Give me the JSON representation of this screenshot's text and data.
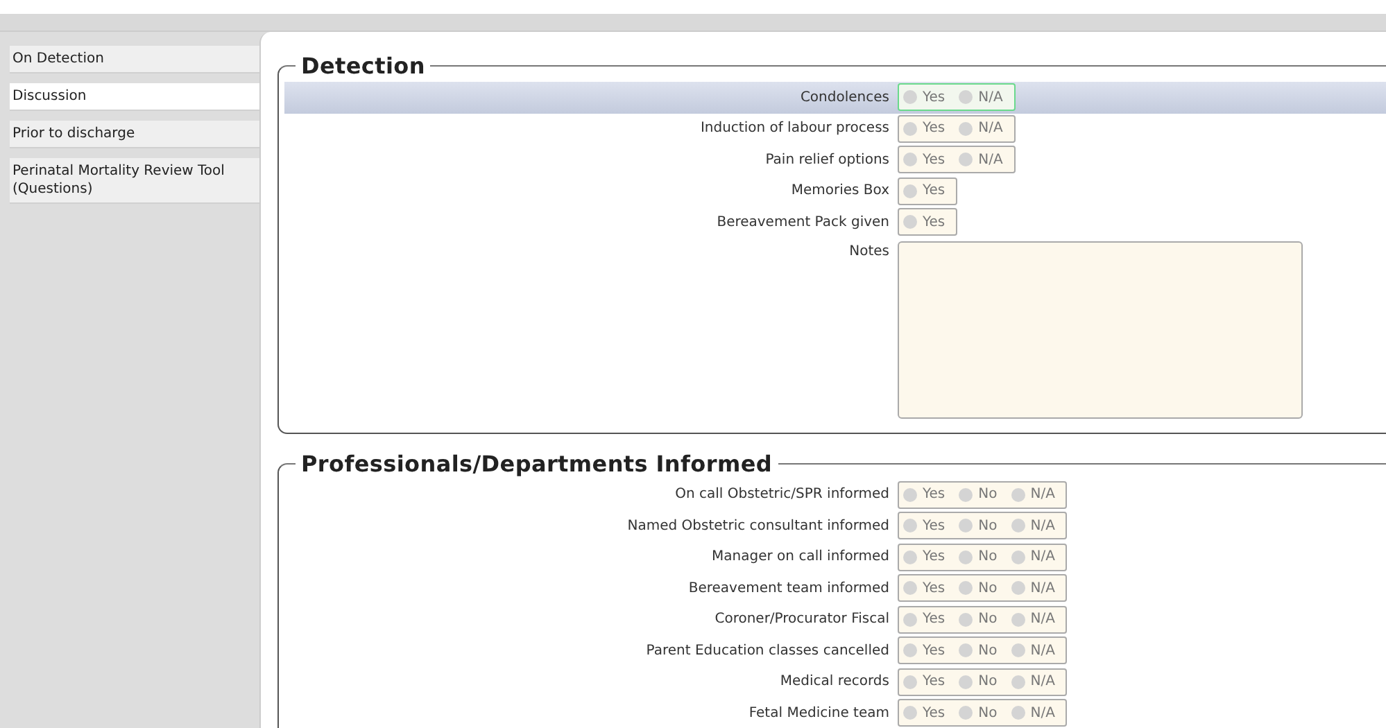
{
  "sidebar": {
    "items": [
      {
        "label": "On Detection",
        "selected": false
      },
      {
        "label": "Discussion",
        "selected": true
      },
      {
        "label": "Prior to discharge",
        "selected": false
      },
      {
        "label": "Perinatal Mortality Review Tool (Questions)",
        "selected": false
      }
    ]
  },
  "sections": [
    {
      "title": "Detection",
      "rows": [
        {
          "kind": "radio",
          "label": "Condolences",
          "focused": true,
          "options": [
            {
              "label": "Yes",
              "selected": false
            },
            {
              "label": "N/A",
              "selected": false
            }
          ]
        },
        {
          "kind": "radio",
          "label": "Induction of labour process",
          "focused": false,
          "options": [
            {
              "label": "Yes",
              "selected": false
            },
            {
              "label": "N/A",
              "selected": false
            }
          ]
        },
        {
          "kind": "radio",
          "label": "Pain relief options",
          "focused": false,
          "options": [
            {
              "label": "Yes",
              "selected": false
            },
            {
              "label": "N/A",
              "selected": false
            }
          ]
        },
        {
          "kind": "radio",
          "label": "Memories Box",
          "focused": false,
          "options": [
            {
              "label": "Yes",
              "selected": false
            }
          ]
        },
        {
          "kind": "radio",
          "label": "Bereavement Pack given",
          "focused": false,
          "options": [
            {
              "label": "Yes",
              "selected": false
            }
          ]
        },
        {
          "kind": "notes",
          "label": "Notes",
          "focused": false
        }
      ]
    },
    {
      "title": "Professionals/Departments Informed",
      "rows": [
        {
          "kind": "radio",
          "label": "On call Obstetric/SPR informed",
          "focused": false,
          "options": [
            {
              "label": "Yes",
              "selected": false
            },
            {
              "label": "No",
              "selected": false
            },
            {
              "label": "N/A",
              "selected": false
            }
          ]
        },
        {
          "kind": "radio",
          "label": "Named Obstetric consultant informed",
          "focused": false,
          "options": [
            {
              "label": "Yes",
              "selected": false
            },
            {
              "label": "No",
              "selected": false
            },
            {
              "label": "N/A",
              "selected": false
            }
          ]
        },
        {
          "kind": "radio",
          "label": "Manager on call informed",
          "focused": false,
          "options": [
            {
              "label": "Yes",
              "selected": false
            },
            {
              "label": "No",
              "selected": false
            },
            {
              "label": "N/A",
              "selected": false
            }
          ]
        },
        {
          "kind": "radio",
          "label": "Bereavement team informed",
          "focused": false,
          "options": [
            {
              "label": "Yes",
              "selected": false
            },
            {
              "label": "No",
              "selected": false
            },
            {
              "label": "N/A",
              "selected": false
            }
          ]
        },
        {
          "kind": "radio",
          "label": "Coroner/Procurator Fiscal",
          "focused": false,
          "options": [
            {
              "label": "Yes",
              "selected": false
            },
            {
              "label": "No",
              "selected": false
            },
            {
              "label": "N/A",
              "selected": false
            }
          ]
        },
        {
          "kind": "radio",
          "label": "Parent Education classes cancelled",
          "focused": false,
          "options": [
            {
              "label": "Yes",
              "selected": false
            },
            {
              "label": "No",
              "selected": false
            },
            {
              "label": "N/A",
              "selected": false
            }
          ]
        },
        {
          "kind": "radio",
          "label": "Medical records",
          "focused": false,
          "options": [
            {
              "label": "Yes",
              "selected": false
            },
            {
              "label": "No",
              "selected": false
            },
            {
              "label": "N/A",
              "selected": false
            }
          ]
        },
        {
          "kind": "radio",
          "label": "Fetal Medicine team",
          "focused": false,
          "options": [
            {
              "label": "Yes",
              "selected": false
            },
            {
              "label": "No",
              "selected": false
            },
            {
              "label": "N/A",
              "selected": false
            }
          ]
        }
      ]
    }
  ]
}
